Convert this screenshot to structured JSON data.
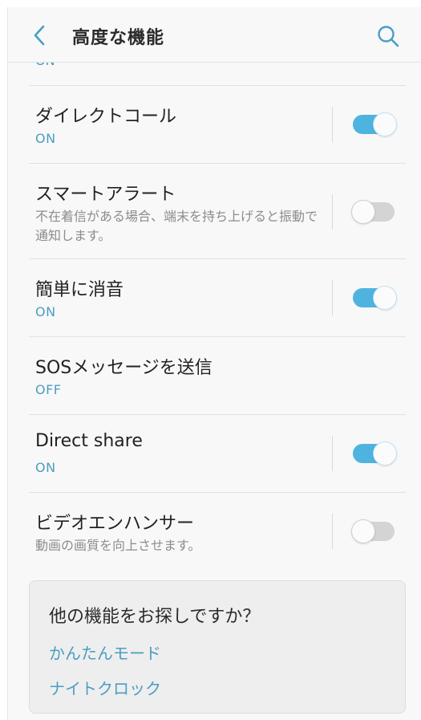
{
  "header": {
    "title": "高度な機能",
    "back_icon": "chevron-left-icon",
    "search_icon": "search-icon"
  },
  "clipped_previous_status": "ON",
  "settings": [
    {
      "title": "ダイレクトコール",
      "status": "ON",
      "toggle": "on"
    },
    {
      "title": "スマートアラート",
      "description": "不在着信がある場合、端末を持ち上げると振動で通知します。",
      "toggle": "off"
    },
    {
      "title": "簡単に消音",
      "status": "ON",
      "toggle": "on"
    },
    {
      "title": "SOSメッセージを送信",
      "status": "OFF"
    },
    {
      "title": "Direct share",
      "status": "ON",
      "toggle": "on"
    },
    {
      "title": "ビデオエンハンサー",
      "description": "動画の画質を向上させます。",
      "toggle": "off"
    }
  ],
  "suggestions": {
    "title": "他の機能をお探しですか？",
    "links": [
      "かんたんモード",
      "ナイトクロック"
    ]
  },
  "colors": {
    "accent": "#4a9ec2",
    "toggle_on": "#4fb3e0",
    "toggle_off": "#d4d4d4",
    "background": "#f8f8f8"
  }
}
